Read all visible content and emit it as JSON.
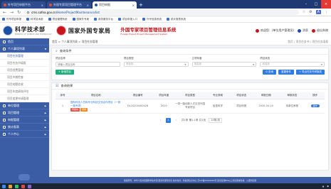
{
  "browser": {
    "tabs": [
      {
        "label": "外专项目申报平台"
      },
      {
        "label": "外国专家项目管理平台"
      },
      {
        "label": "项目申报"
      }
    ],
    "url_host": "cms.safea.gov.cn",
    "url_path": "/Home/ProjectMaintenance/list",
    "bookmarks": [
      "外专项目申报",
      "科学技术部",
      "项目管理系统",
      "国家外专局",
      "政务服务平台",
      "项目申报入口",
      "外专信息系统",
      "统计报表系统"
    ]
  },
  "site": {
    "logo1_text": "科学技术部",
    "logo1_sub": "MINISTRY OF SCIENCE AND TECHNOLOGY",
    "logo2_text": "国家外国专家局",
    "sys_title": "外国专家项目管理信息系统",
    "sys_title_en": "Foreign Expert Project Management System",
    "user": {
      "name": "欢迎您：(单位用户管理员)",
      "messages": "消息",
      "logout": "退出系统"
    }
  },
  "sidebar": {
    "home": "首页",
    "items": [
      {
        "label": "个人事项列表"
      },
      {
        "label": "单位管理"
      },
      {
        "label": "项目管理"
      },
      {
        "label": "申报管理"
      },
      {
        "label": "统计报表"
      },
      {
        "label": "个人中心"
      }
    ],
    "sub_header": "项目任务管理",
    "sub_items": [
      "项目任务书填报",
      "项目经费管理",
      "项目中期检查",
      "项目结题验收",
      "项目年度绩效评估",
      "项目变更申请管理"
    ]
  },
  "breadcrumb": "首页 > 个人事项列表 > 项目任务管理",
  "breadcrumb_right": "首页 / 项目任务书 / 项目任务填报",
  "search": {
    "title": "查询条件",
    "fields": [
      {
        "label": "项目名称",
        "placeholder": "请输入项目名称"
      },
      {
        "label": "项目类型",
        "placeholder": "请选择"
      },
      {
        "label": "立项年度",
        "placeholder": "请选择"
      },
      {
        "label": "项目状态",
        "placeholder": "请选择"
      }
    ],
    "add_button": "+ 新增项目",
    "query_button": "Q 查询",
    "reset_button": "重置条件",
    "export_button": "+ 导出任务书申报表"
  },
  "table": {
    "title": "查询结果",
    "headers": [
      "序号",
      "项目名称",
      "项目编号",
      "项目年度",
      "项目类型",
      "专业领域",
      "项目状态",
      "申报日期",
      "审核状态",
      "操作"
    ],
    "rows": [
      {
        "index": "1",
        "name": "国际科技人员和专业科技交流合作项目（一带一路专项）",
        "tags": [
          "申报中",
          "待审"
        ],
        "code": "DL20200400426",
        "year": "2020",
        "type": "一带一路创新人才交流外国专家项目",
        "field": "信息科学",
        "status": "项目申报",
        "date": "2020-04-10",
        "review": "待单位审核",
        "op": "操作"
      }
    ]
  },
  "pager": {
    "prev": "‹",
    "page": "1",
    "next": "›",
    "summary": "共1条 第1-1条 共1页",
    "per_page": "10条/页"
  },
  "footer": "版权所有：中华人民共和国科学技术部 国家外国专家局   技术支持：科技部信息中心   京ICP备05022684号   建议使用IE9以上浏览器或谷歌、火狐浏览器"
}
